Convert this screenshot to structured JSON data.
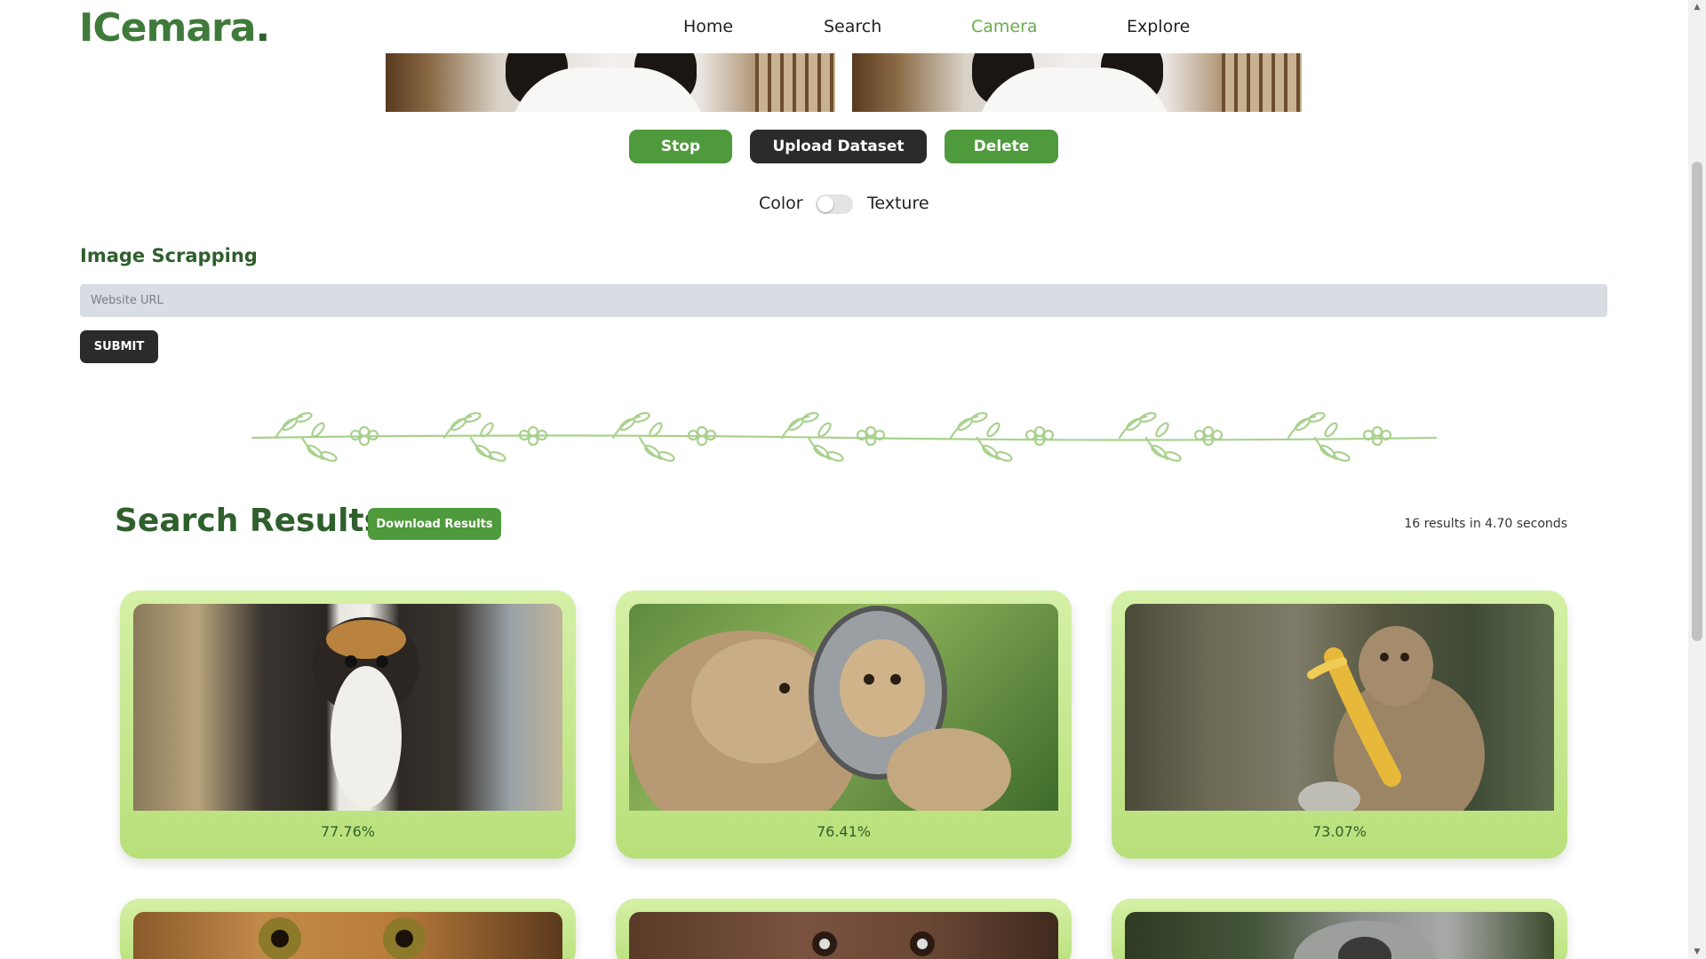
{
  "brand": {
    "logo_text": "Cemara",
    "logo_mark": "I",
    "logo_dot": "."
  },
  "nav": {
    "items": [
      {
        "label": "Home",
        "active": false
      },
      {
        "label": "Search",
        "active": false
      },
      {
        "label": "Camera",
        "active": true
      },
      {
        "label": "Explore",
        "active": false
      }
    ]
  },
  "camera": {
    "stop_label": "Stop",
    "upload_label": "Upload Dataset",
    "delete_label": "Delete",
    "mode_left": "Color",
    "mode_right": "Texture"
  },
  "scrape": {
    "title": "Image Scrapping",
    "url_placeholder": "Website URL",
    "url_value": "",
    "submit_label": "SUBMIT"
  },
  "results": {
    "title": "Search Results",
    "download_label": "Download Results",
    "stats": "16 results in 4.70 seconds",
    "cards": [
      {
        "score": "77.76%",
        "image": "monkey-debrazza"
      },
      {
        "score": "76.41%",
        "image": "monkeys-mirror"
      },
      {
        "score": "73.07%",
        "image": "monkey-banana"
      },
      {
        "score": "",
        "image": "monkey-closeup-eyes"
      },
      {
        "score": "",
        "image": "monkey-closeup-face"
      },
      {
        "score": "",
        "image": "monkey-grey"
      }
    ]
  },
  "colors": {
    "brand_green": "#3f7a3a",
    "dark_green": "#2f5f2c",
    "button_green": "#4f9a3c",
    "active_nav": "#6cab4b",
    "card_light": "#d5f0a6",
    "card_dark": "#b8e07a"
  }
}
